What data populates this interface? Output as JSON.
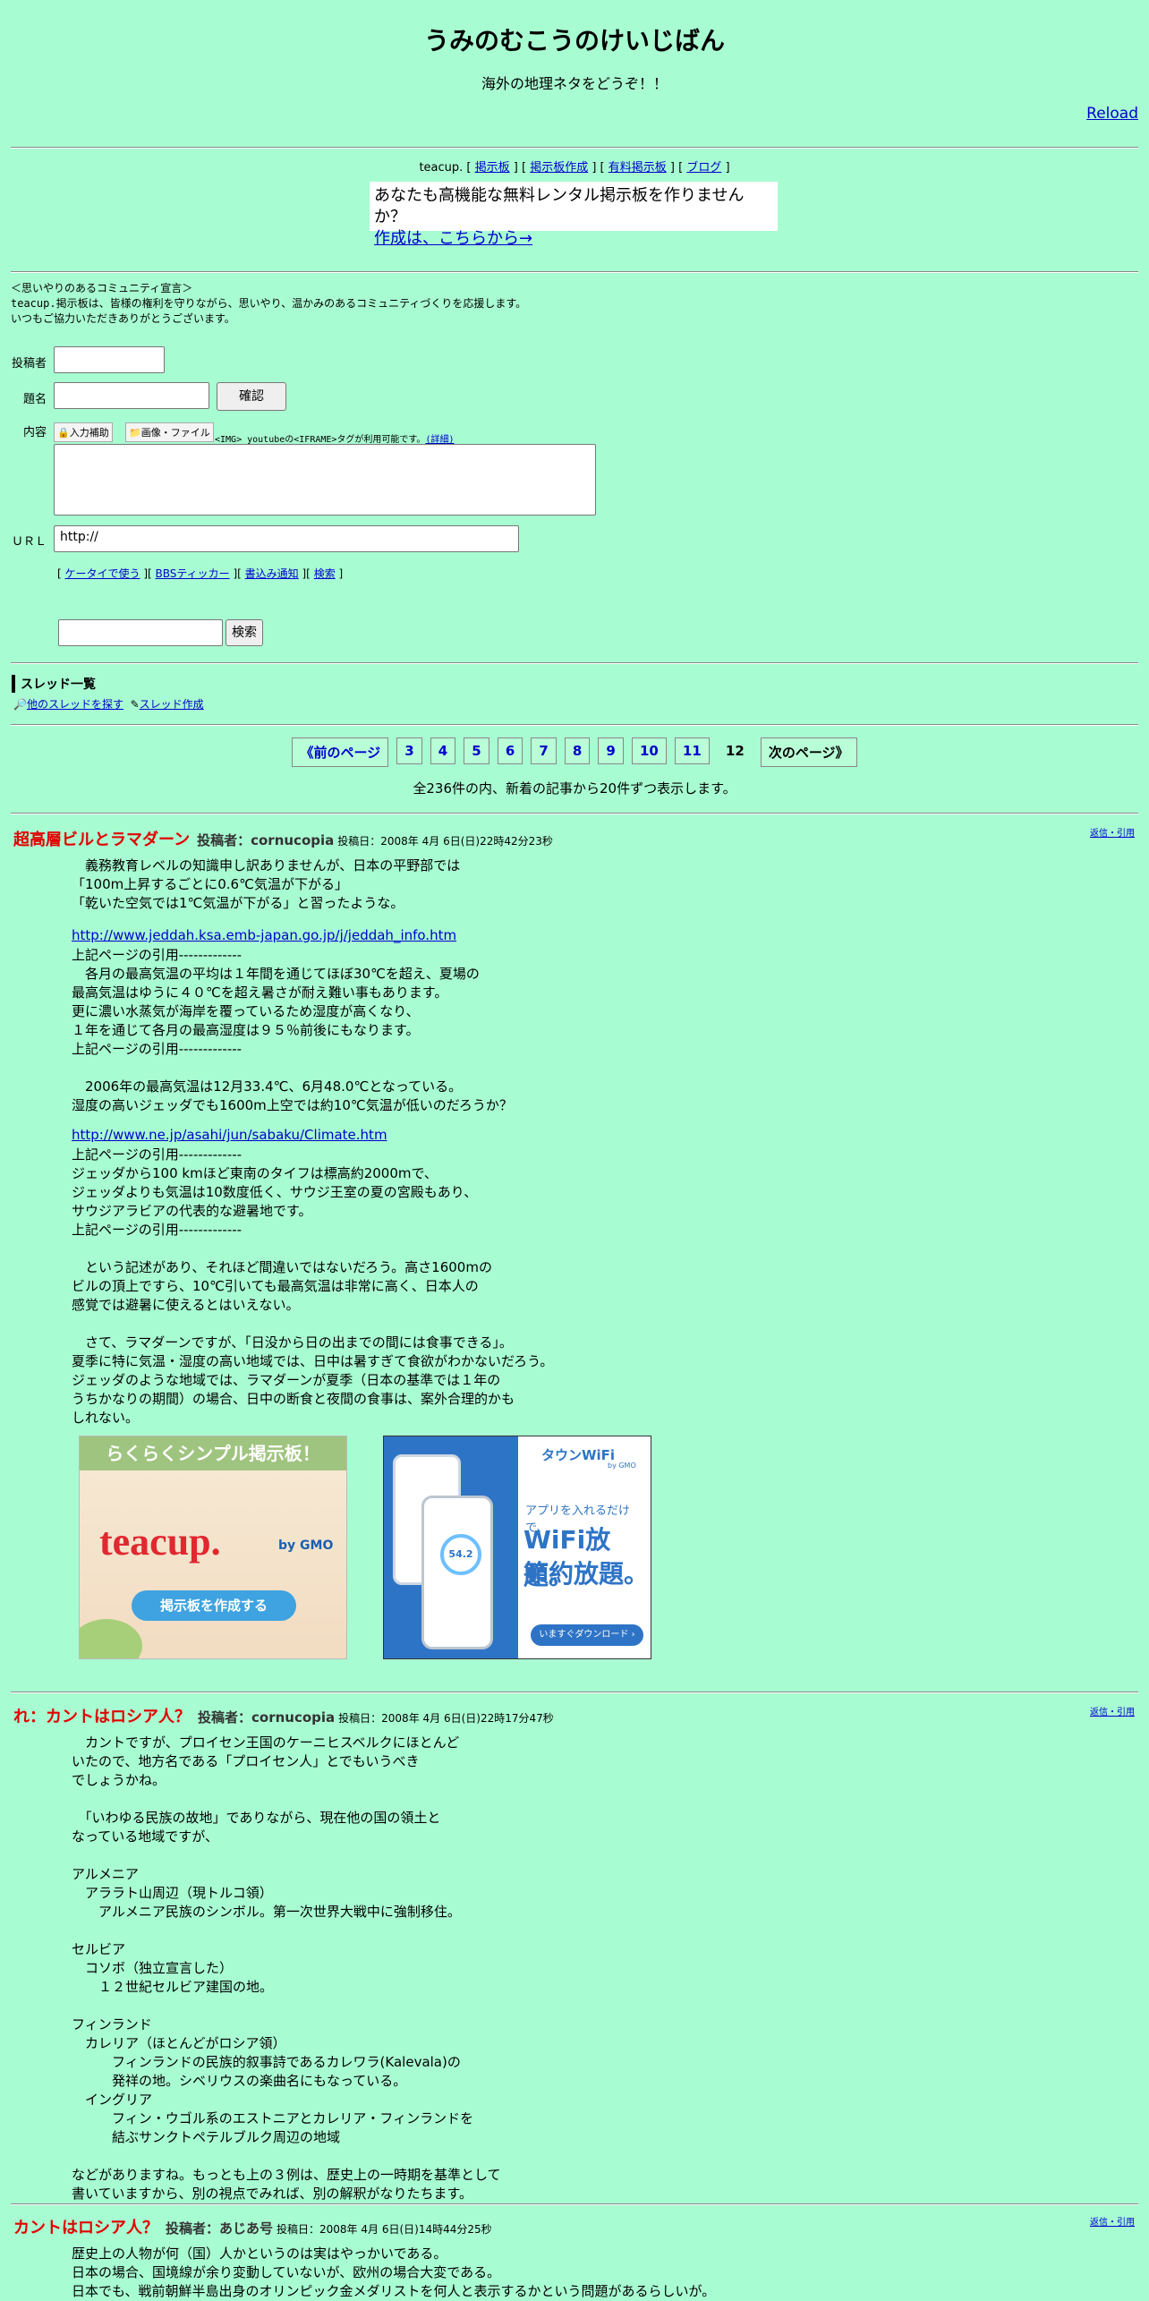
{
  "header": {
    "title": "うみのむこうのけいじばん",
    "subtitle": "海外の地理ネタをどうぞ！！",
    "reload": "Reload"
  },
  "topnav": {
    "prefix": "teacup. [",
    "items": [
      "掲示板",
      "掲示板作成",
      "有料掲示板",
      "ブログ"
    ]
  },
  "promo": {
    "line1": "あなたも高機能な無料レンタル掲示板を作りませんか？",
    "link": "作成は、こちらから→"
  },
  "declaration": {
    "line1": "＜思いやりのあるコミュニティ宣言＞",
    "line2": "teacup.掲示板は、皆様の権利を守りながら、思いやり、温かみのあるコミュニティづくりを応援します。",
    "line3": "いつもご協力いただきありがとうございます。"
  },
  "form": {
    "poster_label": "投稿者",
    "subject_label": "題名",
    "confirm_button": "確認",
    "content_label": "内容",
    "input_assist": "入力補助",
    "image_file": "画像・ファイル",
    "tag_note": "<IMG> youtubeの<IFRAME>タグが利用可能です。",
    "tag_detail": "(詳細)",
    "url_label": "ＵＲＬ",
    "url_value": "http://",
    "links": [
      "ケータイで使う",
      "BBSティッカー",
      "書込み通知",
      "検索"
    ],
    "search_button": "検索"
  },
  "threads": {
    "heading": "スレッド一覧",
    "find": "他のスレッドを探す",
    "create": "スレッド作成"
  },
  "pager": {
    "prev": "《前のページ",
    "pages": [
      "3",
      "4",
      "5",
      "6",
      "7",
      "8",
      "9",
      "10",
      "11"
    ],
    "current": "12",
    "next": "次のページ》",
    "summary": "全236件の内、新着の記事から20件ずつ表示します。"
  },
  "posts": [
    {
      "title": "超高層ビルとラマダーン",
      "author": "投稿者：cornucopia",
      "date": "投稿日：2008年 4月 6日(日)22時42分23秒",
      "reply": "返信・引用",
      "p1": "　義務教育レベルの知識申し訳ありませんが、日本の平野部では\n「100m上昇するごとに0.6℃気温が下がる」\n「乾いた空気では1℃気温が下がる」と習ったような。",
      "link1": "http://www.jeddah.ksa.emb-japan.go.jp/j/jeddah_info.htm",
      "p2": "上記ページの引用-------------\n　各月の最高気温の平均は１年間を通じてほぼ30℃を超え、夏場の\n最高気温はゆうに４０℃を超え暑さが耐え難い事もあります。\n更に濃い水蒸気が海岸を覆っているため湿度が高くなり、\n１年を通じて各月の最高湿度は９５％前後にもなります。\n上記ページの引用-------------\n\n　2006年の最高気温は12月33.4℃、6月48.0℃となっている。\n湿度の高いジェッダでも1600m上空では約10℃気温が低いのだろうか？",
      "link2": "http://www.ne.jp/asahi/jun/sabaku/Climate.htm",
      "p3": "上記ページの引用-------------\nジェッダから100 kmほど東南のタイフは標高約2000mで、\nジェッダよりも気温は10数度低く、サウジ王室の夏の宮殿もあり、\nサウジアラビアの代表的な避暑地です。\n上記ページの引用-------------\n\n　という記述があり、それほど間違いではないだろう。高さ1600mの\nビルの頂上ですら、10℃引いても最高気温は非常に高く、日本人の\n感覚では避暑に使えるとはいえない。\n\n　さて、ラマダーンですが、「日没から日の出までの間には食事できる」。\n夏季に特に気温・湿度の高い地域では、日中は暑すぎて食欲がわかないだろう。\nジェッダのような地域では、ラマダーンが夏季（日本の基準では１年の\nうちかなりの期間）の場合、日中の断食と夜間の食事は、案外合理的かも\nしれない。"
    },
    {
      "title": "れ：カントはロシア人？",
      "author": "投稿者：cornucopia",
      "date": "投稿日：2008年 4月 6日(日)22時17分47秒",
      "reply": "返信・引用",
      "body": "　カントですが、プロイセン王国のケーニヒスベルクにほとんど\nいたので、地方名である「プロイセン人」とでもいうべき\nでしょうかね。\n\n　「いわゆる民族の故地」でありながら、現在他の国の領土と\nなっている地域ですが、\n\nアルメニア\n　アララト山周辺（現トルコ領）\n　　アルメニア民族のシンボル。第一次世界大戦中に強制移住。\n\nセルビア\n　コソボ（独立宣言した）\n　　１２世紀セルビア建国の地。\n\nフィンランド\n　カレリア（ほとんどがロシア領）\n　　　フィンランドの民族的叙事詩であるカレワラ(Kalevala)の\n　　　発祥の地。シベリウスの楽曲名にもなっている。\n　イングリア\n　　　フィン・ウゴル系のエストニアとカレリア・フィンランドを\n　　　結ぶサンクトペテルブルク周辺の地域\n\nなどがありますね。もっとも上の３例は、歴史上の一時期を基準として\n書いていますから、別の視点でみれば、別の解釈がなりたちます。"
    },
    {
      "title": "カントはロシア人？",
      "author": "投稿者：あじあ号",
      "date": "投稿日：2008年 4月 6日(日)14時44分25秒",
      "reply": "返信・引用",
      "body": "歴史上の人物が何（国）人かというのは実はやっかいである。\n日本の場合、国境線が余り変動していないが、欧州の場合大変である。\n日本でも、戦前朝鮮半島出身のオリンピック金メダリストを何人と表示するかという問題があるらしいが。"
    }
  ],
  "ads": {
    "teacup_top": "らくらくシンプル掲示板！",
    "teacup_logo": "teacup.",
    "teacup_by": "by GMO",
    "teacup_button": "掲示板を作成する",
    "wifi_brand": "タウンWiFi",
    "wifi_brand_sub": "by GMO",
    "wifi_line1": "アプリを入れるだけで、",
    "wifi_line2": "WiFi放題。",
    "wifi_line3": "節約放題。",
    "wifi_button": "いますぐダウンロード ›",
    "wifi_screen_value": "54.2"
  }
}
